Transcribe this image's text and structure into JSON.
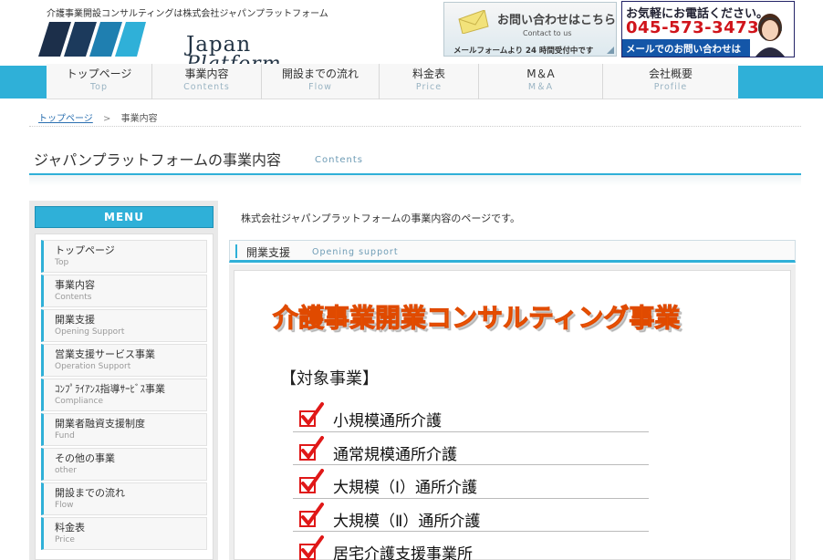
{
  "header": {
    "tagline": "介護事業開設コンサルティングは株式会社ジャパンプラットフォーム",
    "logo_line1": "Japan",
    "logo_line2": "Platform",
    "contact_banner": {
      "title": "お問い合わせはこちら",
      "subtitle": "Contact to us",
      "note": "メールフォームより 24 時間受付中です"
    },
    "phone_banner": {
      "line1": "お気軽にお電話ください。",
      "phone": "045-573-3473",
      "line3": "メールでのお問い合わせはこちら"
    }
  },
  "nav": [
    {
      "jp": "トップページ",
      "en": "Top"
    },
    {
      "jp": "事業内容",
      "en": "Contents"
    },
    {
      "jp": "開設までの流れ",
      "en": "Flow"
    },
    {
      "jp": "料金表",
      "en": "Price"
    },
    {
      "jp": "M＆A",
      "en": "M＆A"
    },
    {
      "jp": "会社概要",
      "en": "Profile"
    }
  ],
  "breadcrumb": {
    "home": "トップページ",
    "separator": ">",
    "current": "事業内容"
  },
  "page_title": {
    "jp": "ジャパンプラットフォームの事業内容",
    "en": "Contents"
  },
  "sidebar": {
    "heading": "MENU",
    "items": [
      {
        "jp": "トップページ",
        "en": "Top"
      },
      {
        "jp": "事業内容",
        "en": "Contents"
      },
      {
        "jp": "開業支援",
        "en": "Opening Support"
      },
      {
        "jp": "営業支援サービス事業",
        "en": "Operation Support"
      },
      {
        "jp": "ｺﾝﾌﾟﾗｲｱﾝｽ指導ｻｰﾋﾞｽ事業",
        "en": "Compliance"
      },
      {
        "jp": "開業者融資支援制度",
        "en": "Fund"
      },
      {
        "jp": "その他の事業",
        "en": "other"
      },
      {
        "jp": "開設までの流れ",
        "en": "Flow"
      },
      {
        "jp": "料金表",
        "en": "Price"
      }
    ]
  },
  "main": {
    "intro": "株式会社ジャパンプラットフォームの事業内容のページです。",
    "section": {
      "jp": "開業支援",
      "en": "Opening support"
    },
    "banner_title": "介護事業開業コンサルティング事業",
    "target_label": "【対象事業】",
    "targets": [
      "小規模通所介護",
      "通常規模通所介護",
      "大規模（Ⅰ）通所介護",
      "大規模（Ⅱ）通所介護",
      "居宅介護支援事業所"
    ]
  },
  "colors": {
    "accent": "#2fb0d8",
    "banner_orange": "#ff6a00",
    "check_red": "#e01818",
    "phone_red": "#d0141b"
  }
}
